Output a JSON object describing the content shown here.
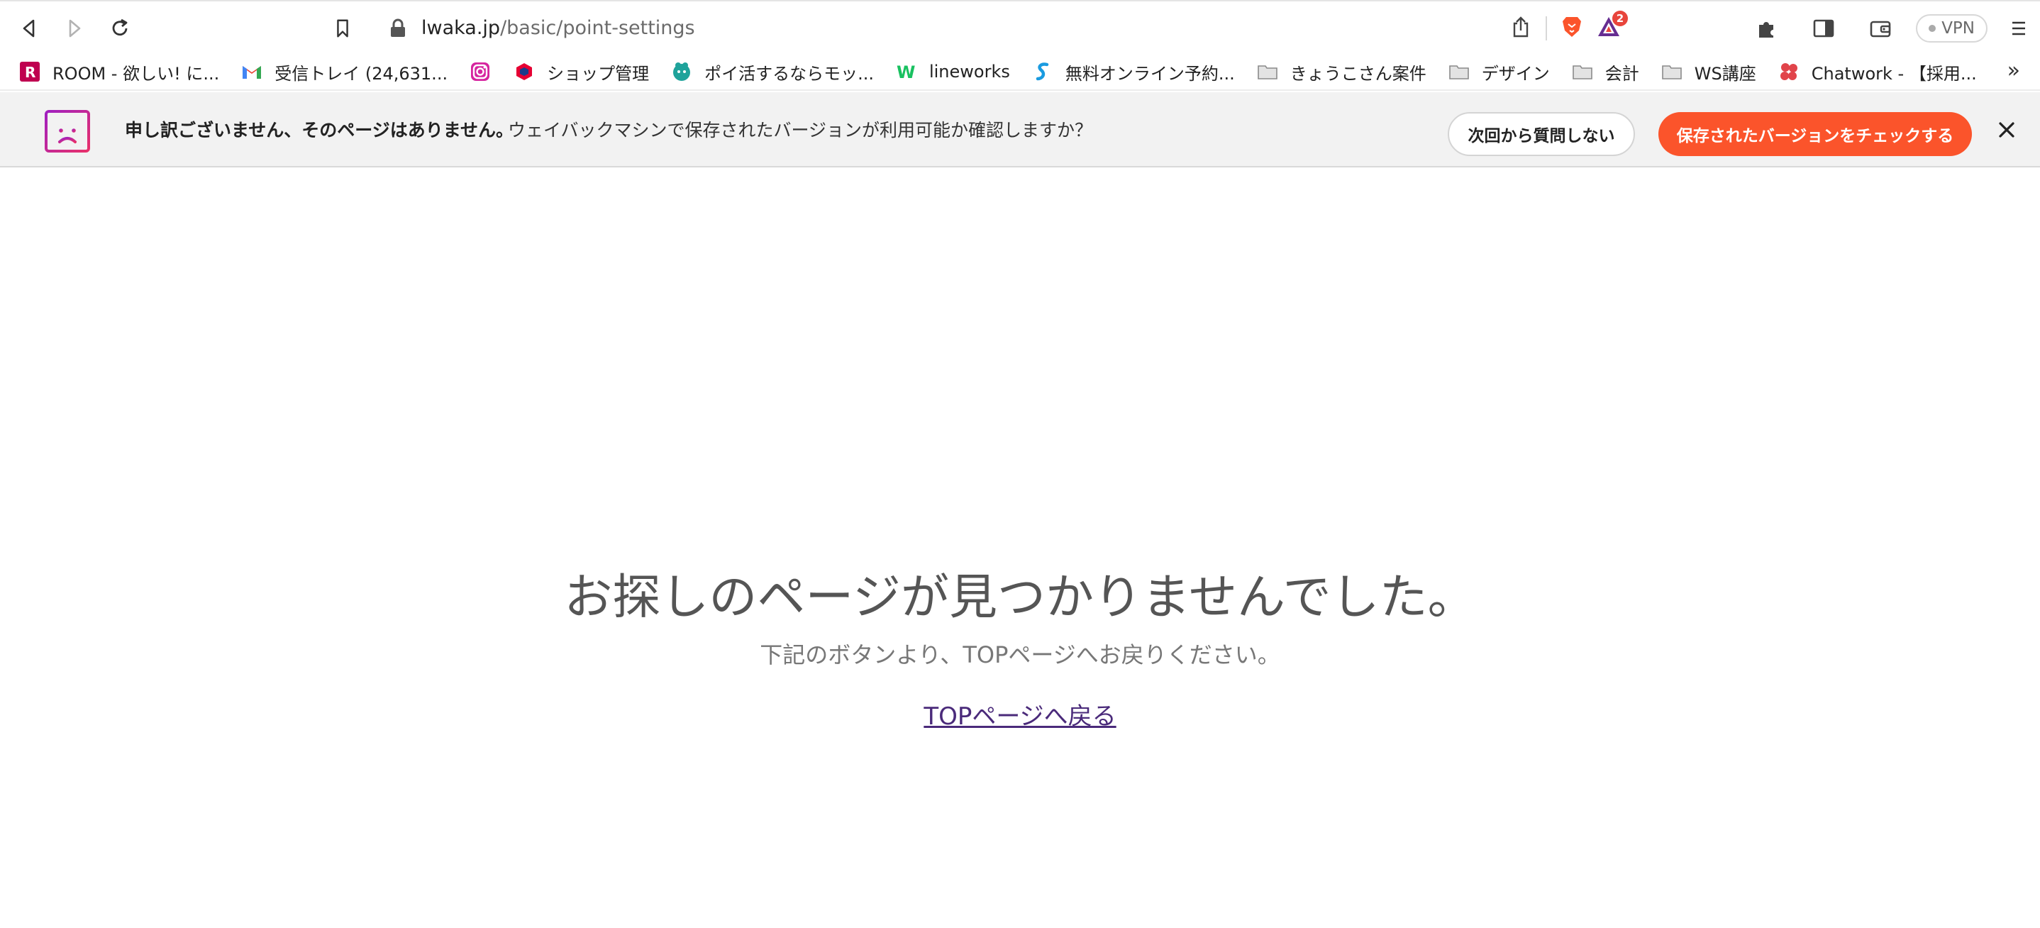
{
  "browser": {
    "url_host": "lwaka.jp",
    "url_path": "/basic/point-settings",
    "rewards_badge": "2",
    "vpn_label": "VPN"
  },
  "bookmarks": [
    {
      "label": "ROOM - 欲しい! に...",
      "icon": "rakuten-room-icon"
    },
    {
      "label": "受信トレイ (24,631...",
      "icon": "gmail-icon"
    },
    {
      "label": "",
      "icon": "instagram-icon"
    },
    {
      "label": "ショップ管理",
      "icon": "shop-icon"
    },
    {
      "label": "ポイ活するならモッ...",
      "icon": "moppy-icon"
    },
    {
      "label": "lineworks",
      "icon": "lineworks-icon"
    },
    {
      "label": "無料オンライン予約...",
      "icon": "reservation-icon"
    },
    {
      "label": "きょうこさん案件",
      "icon": "folder-icon"
    },
    {
      "label": "デザイン",
      "icon": "folder-icon"
    },
    {
      "label": "会計",
      "icon": "folder-icon"
    },
    {
      "label": "WS講座",
      "icon": "folder-icon"
    },
    {
      "label": "Chatwork - 【採用...",
      "icon": "chatwork-icon"
    }
  ],
  "bookmarks_more": "»",
  "infobar": {
    "title": "申し訳ございません、そのページはありません。",
    "text": "ウェイバックマシンで保存されたバージョンが利用可能か確認しますか？",
    "dismiss_label": "次回から質問しない",
    "check_label": "保存されたバージョンをチェックする",
    "accent_color": "#fb542b"
  },
  "page": {
    "heading": "お探しのページが見つかりませんでした。",
    "subtext": "下記のボタンより、TOPページへお戻りください。",
    "top_link": "TOPページへ戻る"
  }
}
